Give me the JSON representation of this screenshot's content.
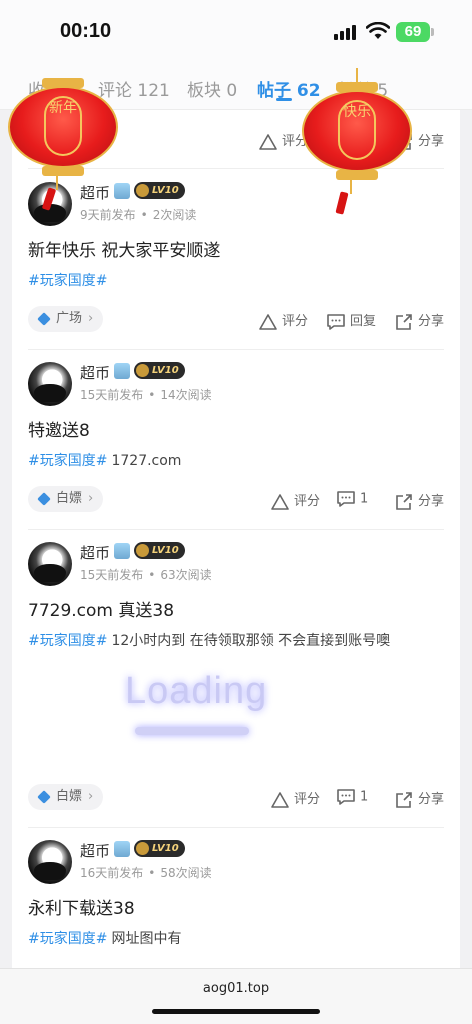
{
  "status_bar": {
    "time": "00:10",
    "battery": "69"
  },
  "tabs": [
    {
      "label": "收藏",
      "count": "0"
    },
    {
      "label": "评论",
      "count": "121"
    },
    {
      "label": "板块",
      "count": "0"
    },
    {
      "label": "帖子",
      "count": "62"
    },
    {
      "label": "粉丝",
      "count": "5"
    }
  ],
  "lanterns": [
    {
      "text": "新年"
    },
    {
      "text": "快乐"
    }
  ],
  "top_actions": {
    "rate": "评分",
    "share": "分享"
  },
  "posts": [
    {
      "username": "超币",
      "level": "LV10",
      "time_ago": "9天前发布",
      "views": "2次阅读",
      "title": "新年快乐 祝大家平安顺遂",
      "tag": "#玩家国度#",
      "tag_text": "",
      "category": "广场",
      "rate": "评分",
      "reply": "回复",
      "share": "分享"
    },
    {
      "username": "超币",
      "level": "LV10",
      "time_ago": "15天前发布",
      "views": "14次阅读",
      "title": "特邀送8",
      "tag": "#玩家国度#",
      "tag_text": "1727.com",
      "category": "白嫖",
      "rate": "评分",
      "reply": "1",
      "share": "分享"
    },
    {
      "username": "超币",
      "level": "LV10",
      "time_ago": "15天前发布",
      "views": "63次阅读",
      "title": "7729.com 真送38",
      "tag": "#玩家国度#",
      "tag_text": "12小时内到 在待领取那领 不会直接到账号噢",
      "category": "白嫖",
      "rate": "评分",
      "reply": "1",
      "share": "分享"
    },
    {
      "username": "超币",
      "level": "LV10",
      "time_ago": "16天前发布",
      "views": "58次阅读",
      "title": "永利下载送38",
      "tag": "#玩家国度#",
      "tag_text": "网址图中有"
    }
  ],
  "loading": "Loading",
  "url": "aog01.top",
  "colors": {
    "accent": "#2f8fe6",
    "lantern_red": "#e71c1c",
    "lantern_gold": "#e8b445"
  }
}
